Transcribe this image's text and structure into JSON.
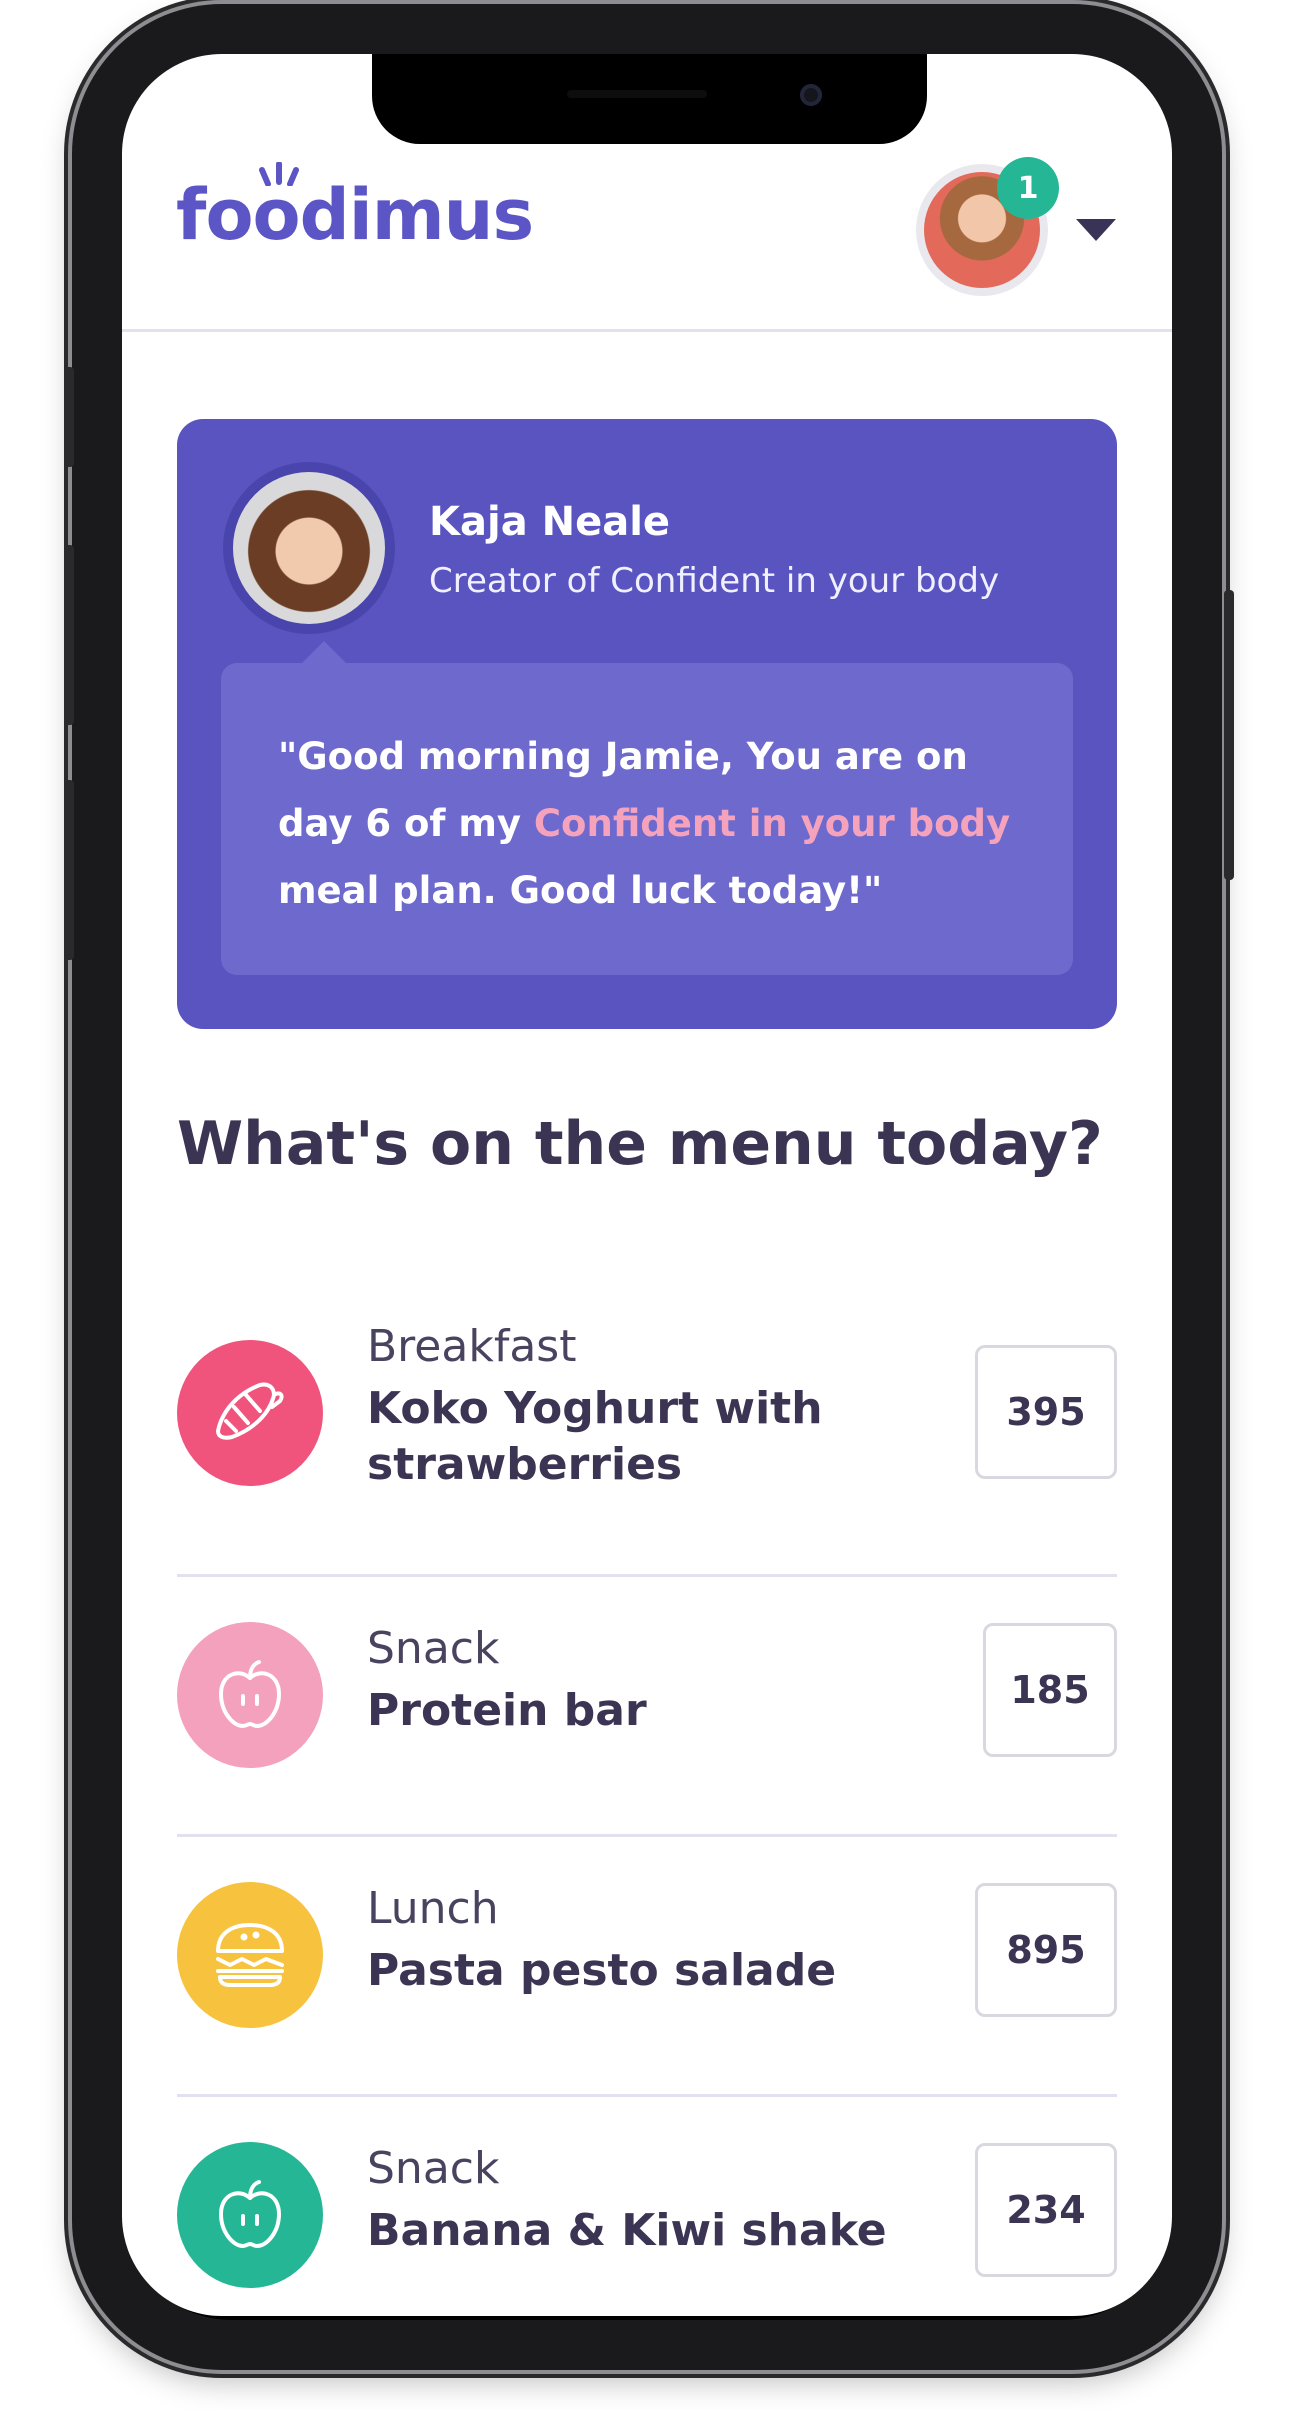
{
  "app": {
    "logo_text": "foodimus",
    "notification_count": "1",
    "brand_color": "#5b55c6"
  },
  "coach": {
    "name": "Kaja Neale",
    "role": "Creator of Confident in your body",
    "message_part1": "\"Good morning Jamie, You are on day 6 of my ",
    "message_highlight": "Confident in your body",
    "message_part2": " meal plan. Good luck today!\""
  },
  "menu": {
    "heading": "What's on the menu today?",
    "items": [
      {
        "type": "Breakfast",
        "name": "Koko Yoghurt with strawberries",
        "calories": "395",
        "icon": "croissant-icon",
        "color": "#f0547c"
      },
      {
        "type": "Snack",
        "name": "Protein bar",
        "calories": "185",
        "icon": "apple-icon",
        "color": "#f4a1bd"
      },
      {
        "type": "Lunch",
        "name": "Pasta pesto salade",
        "calories": "895",
        "icon": "burger-icon",
        "color": "#f7c33f"
      },
      {
        "type": "Snack",
        "name": "Banana & Kiwi shake",
        "calories": "234",
        "icon": "apple-icon",
        "color": "#25b795"
      }
    ]
  }
}
